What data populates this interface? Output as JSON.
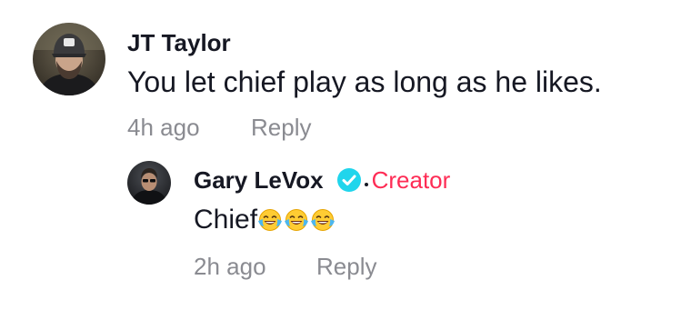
{
  "comments": [
    {
      "username": "JT Taylor",
      "text": "You let chief play as long as he likes.",
      "time": "4h ago",
      "reply_label": "Reply",
      "avatar_icon": "user-avatar"
    }
  ],
  "reply": {
    "username": "Gary LeVox",
    "verified_icon": "verified-badge-icon",
    "separator": "·",
    "creator_label": "Creator",
    "text": "Chief",
    "emojis": [
      "😂",
      "😂",
      "😂"
    ],
    "time": "2h ago",
    "reply_label": "Reply",
    "avatar_icon": "user-avatar"
  },
  "colors": {
    "text": "#161823",
    "muted": "#8a8b91",
    "creator": "#fe2c55",
    "verified": "#20d5ec"
  }
}
